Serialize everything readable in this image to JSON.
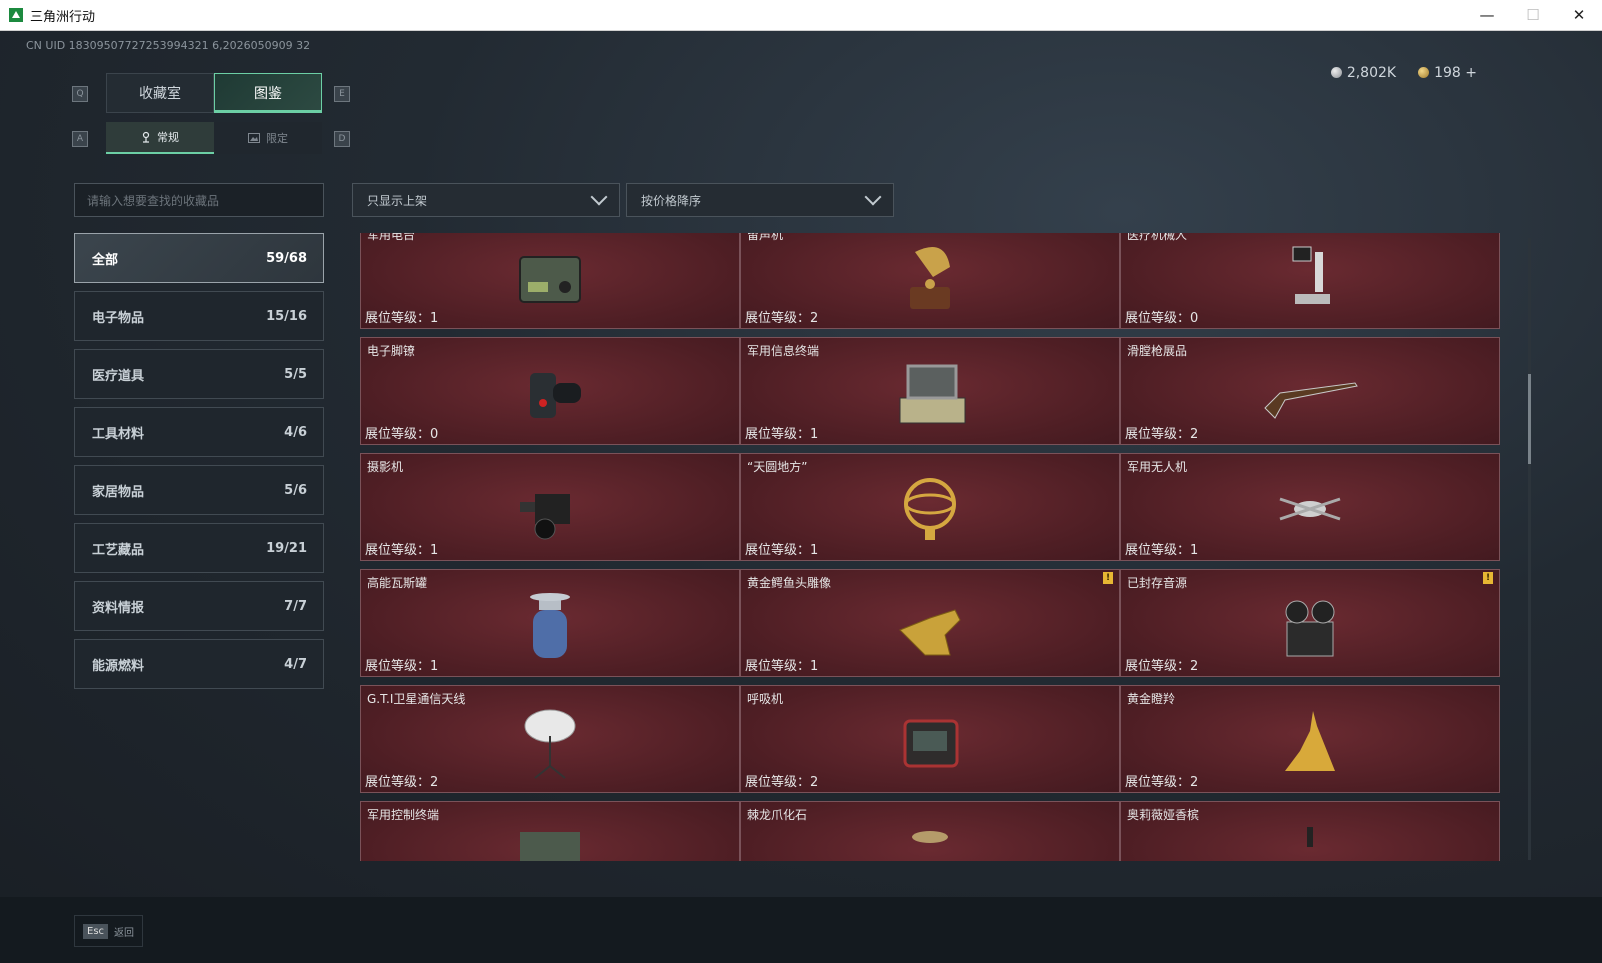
{
  "window": {
    "title": "三角洲行动",
    "controls": [
      "—",
      "☐",
      "✕"
    ]
  },
  "uid": "CN UID 18309507727253994321 6,2026050909 32",
  "currency": {
    "silver": "2,802K",
    "gold": "198",
    "add_label": "+"
  },
  "keys": {
    "q": "Q",
    "e": "E",
    "a": "A",
    "d": "D"
  },
  "tabs": [
    {
      "label": "收藏室",
      "active": false
    },
    {
      "label": "图鉴",
      "active": true
    }
  ],
  "subtabs": [
    {
      "label": "常规",
      "active": true,
      "icon": "pin-icon"
    },
    {
      "label": "限定",
      "active": false,
      "icon": "image-icon"
    }
  ],
  "search": {
    "placeholder": "请输入想要查找的收藏品"
  },
  "filters": {
    "shelf": "只显示上架",
    "sort": "按价格降序"
  },
  "categories": [
    {
      "label": "全部",
      "count": "59/68",
      "active": true
    },
    {
      "label": "电子物品",
      "count": "15/16",
      "active": false
    },
    {
      "label": "医疗道具",
      "count": "5/5",
      "active": false
    },
    {
      "label": "工具材料",
      "count": "4/6",
      "active": false
    },
    {
      "label": "家居物品",
      "count": "5/6",
      "active": false
    },
    {
      "label": "工艺藏品",
      "count": "19/21",
      "active": false
    },
    {
      "label": "资料情报",
      "count": "7/7",
      "active": false
    },
    {
      "label": "能源燃料",
      "count": "4/7",
      "active": false
    }
  ],
  "level_label": "展位等级：",
  "items": [
    {
      "name": "军用电台",
      "level": "1",
      "icon": "radio-icon",
      "alert": false
    },
    {
      "name": "留声机",
      "level": "2",
      "icon": "gramophone-icon",
      "alert": false
    },
    {
      "name": "医疗机械人",
      "level": "0",
      "icon": "robot-arm-icon",
      "alert": false
    },
    {
      "name": "电子脚镣",
      "level": "0",
      "icon": "ankle-monitor-icon",
      "alert": false
    },
    {
      "name": "军用信息终端",
      "level": "1",
      "icon": "laptop-case-icon",
      "alert": false
    },
    {
      "name": "滑膛枪展品",
      "level": "2",
      "icon": "musket-icon",
      "alert": false
    },
    {
      "name": "摄影机",
      "level": "1",
      "icon": "camera-icon",
      "alert": false
    },
    {
      "name": "“天圆地方”",
      "level": "1",
      "icon": "armillary-icon",
      "alert": false
    },
    {
      "name": "军用无人机",
      "level": "1",
      "icon": "drone-icon",
      "alert": false
    },
    {
      "name": "高能瓦斯罐",
      "level": "1",
      "icon": "gas-tank-icon",
      "alert": false
    },
    {
      "name": "黄金鳄鱼头雕像",
      "level": "1",
      "icon": "gold-croc-icon",
      "alert": true
    },
    {
      "name": "已封存音源",
      "level": "2",
      "icon": "reel-recorder-icon",
      "alert": true
    },
    {
      "name": "G.T.I卫星通信天线",
      "level": "2",
      "icon": "satellite-dish-icon",
      "alert": false
    },
    {
      "name": "呼吸机",
      "level": "2",
      "icon": "ventilator-icon",
      "alert": false
    },
    {
      "name": "黄金瞪羚",
      "level": "2",
      "icon": "gold-gazelle-icon",
      "alert": false
    },
    {
      "name": "军用控制终端",
      "level": "",
      "icon": "control-terminal-icon",
      "alert": false
    },
    {
      "name": "棘龙爪化石",
      "level": "",
      "icon": "fossil-icon",
      "alert": false
    },
    {
      "name": "奥莉薇娅香槟",
      "level": "",
      "icon": "champagne-icon",
      "alert": false
    }
  ],
  "footer": {
    "key": "Esc",
    "label": "返回"
  },
  "alert_mark": "!"
}
